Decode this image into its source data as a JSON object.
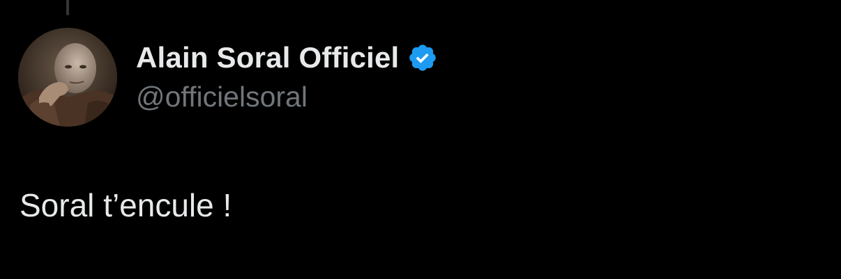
{
  "tweet": {
    "author": {
      "display_name": "Alain Soral Officiel",
      "handle": "@officielsoral",
      "verified": true,
      "verified_icon": "verified-badge-icon",
      "verified_color": "#1d9bf0",
      "avatar": "profile-photo"
    },
    "text": "Soral t’encule !"
  },
  "theme": {
    "background": "#000000",
    "primary_text": "#e7e9ea",
    "secondary_text": "#71767b",
    "thread_line": "#333639"
  }
}
